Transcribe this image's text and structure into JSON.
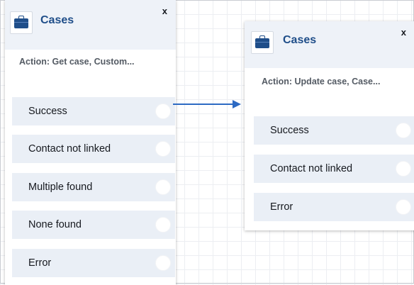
{
  "blocks": [
    {
      "title": "Cases",
      "close": "x",
      "icon": "briefcase-icon",
      "action": "Action: Get case, Custom...",
      "branches": [
        "Success",
        "Contact not linked",
        "Multiple found",
        "None found",
        "Error"
      ]
    },
    {
      "title": "Cases",
      "close": "x",
      "icon": "briefcase-icon",
      "action": "Action: Update case, Case...",
      "branches": [
        "Success",
        "Contact not linked",
        "Error"
      ]
    }
  ],
  "colors": {
    "title": "#1f4e89",
    "connector": "#2d6ac3",
    "branch_bg": "#eaeff6",
    "header_bg": "#eef2f8"
  }
}
